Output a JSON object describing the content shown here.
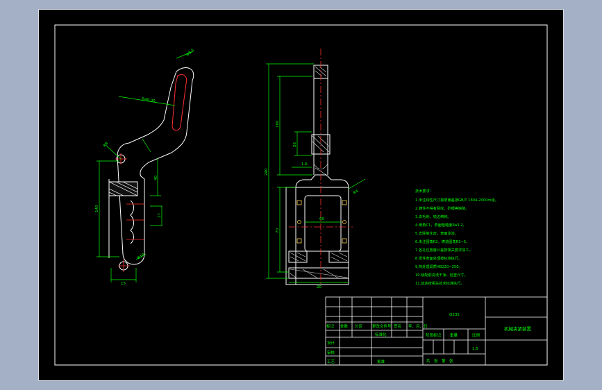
{
  "colors": {
    "background": "#a4b0c6",
    "paper": "#000000",
    "frame": "#ffffff",
    "dimension": "#00ff00",
    "centerline": "#ff2020",
    "accent": "#ffd24a"
  },
  "drawing": {
    "left_view": {
      "dims": {
        "top_dia": "Φ8.5",
        "radius": "R40.00",
        "arm_dim": "R8",
        "left_vertical": "140",
        "right_upper": "40",
        "right_lower": "17",
        "bottom_hole": "Φ10",
        "bottom_width": "15"
      }
    },
    "right_view": {
      "dims": {
        "overall_height": "240",
        "stem_height": "100",
        "mid_height": "26",
        "lower_height": "70",
        "top_small": "1.6",
        "chamfer": "R4",
        "inner_width": "60",
        "base_width": "20"
      }
    },
    "notes": {
      "title": "技术要求：",
      "lines": [
        "1.未注线性尺寸极限偏差按GB/T 1804-2000m级。",
        "2.铸件不得有裂纹、砂眼等缺陷。",
        "3.去毛刺，锐边倒钝。",
        "4.倒角C1，表面粗糙度Ra3.2。",
        "5.去除氧化皮，表面涂漆。",
        "6.未注圆角R2，铸造圆角R3~5。",
        "7.各孔位置度公差按相关要求加工。",
        "8.零件表面处理按标准执行。",
        "9.热处理调质HB220~250。",
        "10.装配前清洗干净，检查尺寸。",
        "11.其余按相关技术标准执行。"
      ]
    },
    "title_block": {
      "material": "Q235",
      "part_name": "机械夹紧装置",
      "header_cells": [
        "标记",
        "处数",
        "分区",
        "更改文件号",
        "签名",
        "年、月、日"
      ],
      "roles": [
        "设计",
        "审核",
        "工艺"
      ],
      "standardization": "标准化",
      "approve": "批准",
      "stage_mark": "阶段标记",
      "weight": "重量",
      "scale": "比例",
      "scale_value": "1:5",
      "sheets": "共　张　第　张"
    }
  }
}
